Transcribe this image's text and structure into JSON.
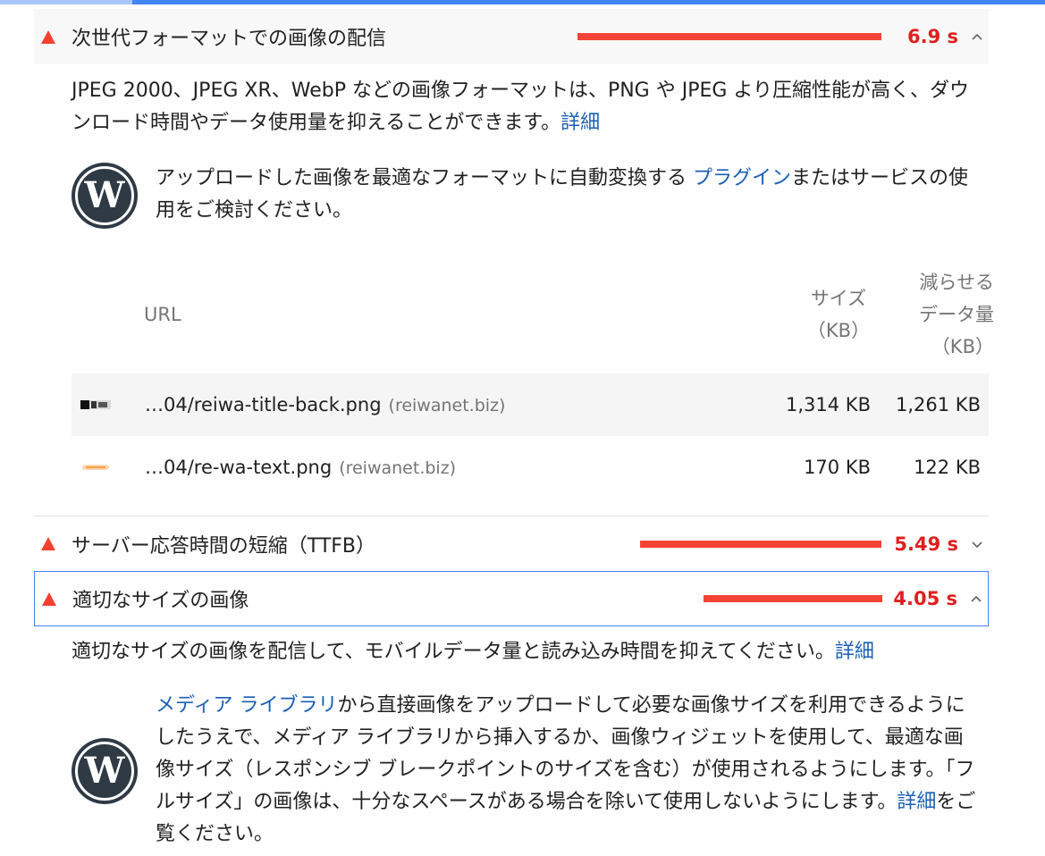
{
  "audits": [
    {
      "title": "次世代フォーマットでの画像の配信",
      "score": "6.9 s",
      "description": "JPEG 2000、JPEG XR、WebP などの画像フォーマットは、PNG や JPEG より圧縮性能が高く、ダウンロード時間やデータ使用量を抑えることができます。",
      "learn_more": "詳細",
      "wp_tip_before": "アップロードした画像を最適なフォーマットに自動変換する ",
      "wp_tip_link": "プラグイン",
      "wp_tip_after": "またはサービスの使用をご検討ください。",
      "table": {
        "col_url": "URL",
        "col_size": "サイズ（KB）",
        "col_saved": "減らせるデータ量（KB）",
        "rows": [
          {
            "url": "…04/reiwa-title-back.png",
            "host": "(reiwanet.biz)",
            "size": "1,314 KB",
            "saved": "1,261 KB"
          },
          {
            "url": "…04/re-wa-text.png",
            "host": "(reiwanet.biz)",
            "size": "170 KB",
            "saved": "122 KB"
          }
        ]
      }
    },
    {
      "title": "サーバー応答時間の短縮（TTFB）",
      "score": "5.49 s"
    },
    {
      "title": "適切なサイズの画像",
      "score": "4.05 s",
      "description": "適切なサイズの画像を配信して、モバイルデータ量と読み込み時間を抑えてください。",
      "learn_more": "詳細",
      "wp_tip_link": "メディア ライブラリ",
      "wp_tip_after": "から直接画像をアップロードして必要な画像サイズを利用できるようにしたうえで、メディア ライブラリから挿入するか、画像ウィジェットを使用して、最適な画像サイズ（レスポンシブ ブレークポイントのサイズを含む）が使用されるようにします。「フルサイズ」の画像は、十分なスペースがある場合を除いて使用しないようにします。",
      "wp_tip_link2": "詳細",
      "wp_tip_end": "をご覧ください。"
    }
  ],
  "colors": {
    "fail": "#f44336",
    "link": "#1a5fb4"
  }
}
